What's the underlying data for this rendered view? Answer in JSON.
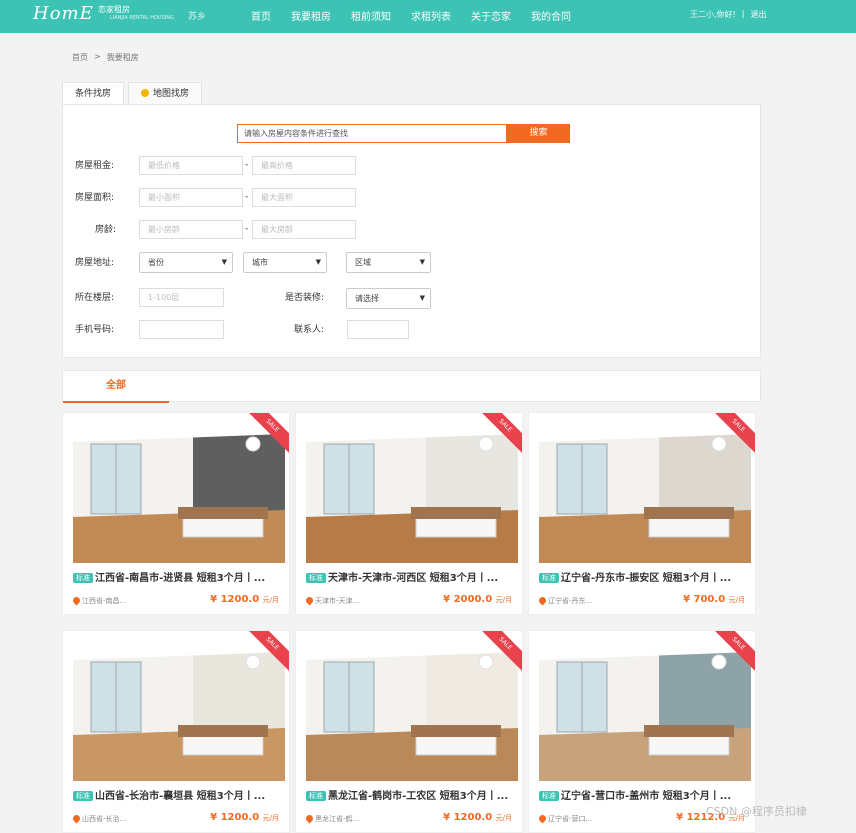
{
  "header": {
    "logo": "HomE",
    "logo_cn": "恋家租房",
    "logo_tagline": "LIANJIA RENTAL HOUSING",
    "city": "苏乡",
    "nav": [
      "首页",
      "我要租房",
      "租前须知",
      "求租列表",
      "关于恋家",
      "我的合同"
    ],
    "username": "王二小",
    "greeting": ",你好!",
    "separator": "|",
    "logout": "退出"
  },
  "breadcrumb": {
    "home": "首页",
    "sep": ">",
    "current": "我要租房"
  },
  "tabs": [
    "条件找房",
    "地图找房"
  ],
  "search": {
    "placeholder": "请输入房屋内容条件进行查找",
    "button": "搜索"
  },
  "filters": {
    "rent_label": "房屋租金:",
    "rent_min": "最低价格",
    "rent_max": "最高价格",
    "area_label": "房屋面积:",
    "area_min": "最小面积",
    "area_max": "最大面积",
    "age_label": "房龄:",
    "age_min": "最小房龄",
    "age_max": "最大房龄",
    "dash": "-",
    "address_label": "房屋地址:",
    "province": "省份",
    "city": "城市",
    "district": "区域",
    "floor_label": "所在楼层:",
    "floor_placeholder": "1-100层",
    "decor_label": "是否装修:",
    "decor_value": "请选择",
    "phone_label": "手机号码:",
    "contact_label": "联系人:"
  },
  "filter_tab": "全部",
  "listings": [
    {
      "badge": "标准",
      "title": "江西省-南昌市-进贤县 短租3个月丨...",
      "location": "江西省-南昌...",
      "price": "¥ 1200.0",
      "unit": "元/月",
      "sale": "SALE",
      "wall": "#5f5f5f"
    },
    {
      "badge": "标准",
      "title": "天津市-天津市-河西区 短租3个月丨...",
      "location": "天津市-天津...",
      "price": "¥ 2000.0",
      "unit": "元/月",
      "sale": "SALE",
      "wall": "#e8e6e1"
    },
    {
      "badge": "标准",
      "title": "辽宁省-丹东市-振安区 短租3个月丨...",
      "location": "辽宁省-丹东...",
      "price": "¥ 700.0",
      "unit": "元/月",
      "sale": "SALE",
      "wall": "#ddd8cf"
    },
    {
      "badge": "标准",
      "title": "山西省-长治市-襄垣县 短租3个月丨...",
      "location": "山西省-长治...",
      "price": "¥ 1200.0",
      "unit": "元/月",
      "sale": "SALE",
      "wall": "#e9e6de"
    },
    {
      "badge": "标准",
      "title": "黑龙江省-鹤岗市-工农区 短租3个月丨...",
      "location": "黑龙江省-鹤...",
      "price": "¥ 1200.0",
      "unit": "元/月",
      "sale": "SALE",
      "wall": "#f0ebe2"
    },
    {
      "badge": "标准",
      "title": "辽宁省-营口市-盖州市 短租3个月丨...",
      "location": "辽宁省-营口...",
      "price": "¥ 1212.0",
      "unit": "元/月",
      "sale": "SALE",
      "wall": "#8ea3a8"
    }
  ],
  "watermark": "CSDN @程序员扣棣"
}
